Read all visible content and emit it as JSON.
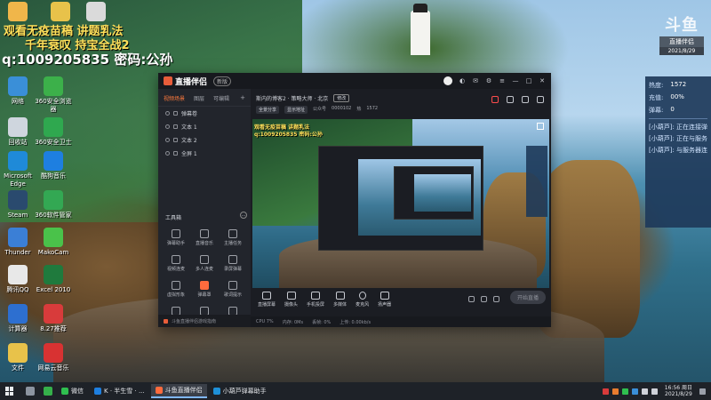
{
  "overlay": {
    "line1": "观看无疫苗稿 讲题乳法",
    "line2": "千年衰叹 持宝全战2",
    "line3": "q:1009205835 密码:公孙"
  },
  "desktop_icons": [
    {
      "label": "",
      "icon": "doc-icon",
      "color": "#f0b64a"
    },
    {
      "label": "",
      "icon": "folder-icon",
      "color": "#e8c24a"
    },
    {
      "label": "",
      "icon": "file-icon",
      "color": "#dadada"
    },
    {
      "label": "网络",
      "icon": "network-icon",
      "color": "#3a8fd8"
    },
    {
      "label": "360安全浏览器",
      "icon": "browser-360-icon",
      "color": "#3cb04a"
    },
    {
      "label": "回收站",
      "icon": "recycle-bin-icon",
      "color": "#cfd6de"
    },
    {
      "label": "360安全卫士",
      "icon": "shield-360-icon",
      "color": "#2fa84f"
    },
    {
      "label": "Microsoft Edge",
      "icon": "edge-icon",
      "color": "#1f8ad8"
    },
    {
      "label": "酷狗音乐",
      "icon": "kugou-icon",
      "color": "#1e7fe0"
    },
    {
      "label": "Steam",
      "icon": "steam-icon",
      "color": "#2a4a6e"
    },
    {
      "label": "360软件管家",
      "icon": "software-manager-icon",
      "color": "#33a853"
    },
    {
      "label": "Thunder",
      "icon": "thunder-icon",
      "color": "#3b7fd6"
    },
    {
      "label": "MakoCam",
      "icon": "makocam-icon",
      "color": "#4ac24a"
    },
    {
      "label": "腾讯QQ",
      "icon": "qq-icon",
      "color": "#e8e8e8"
    },
    {
      "label": "Excel 2010",
      "icon": "excel-icon",
      "color": "#1f7a3d"
    },
    {
      "label": "计算器",
      "icon": "calculator-icon",
      "color": "#2d6fd0"
    },
    {
      "label": "8.27推荐",
      "icon": "recommend-icon",
      "color": "#d83b3b"
    },
    {
      "label": "文件",
      "icon": "file-folder-icon",
      "color": "#e8c24a"
    },
    {
      "label": "网易云音乐",
      "icon": "netease-music-icon",
      "color": "#d83232"
    }
  ],
  "top_right": {
    "big": "斗鱼",
    "badge": "直播伴侣",
    "small": "2021/8/29"
  },
  "stats_panel": {
    "heat_label": "热度:",
    "heat_value": "1572",
    "gift_label": "充值:",
    "gift_value": "00%",
    "fans_label": "弹幕:",
    "fans_value": "0",
    "log": [
      "[小葫芦]: 正在连接弹",
      "[小葫芦]: 正在与服务",
      "[小葫芦]: 与服务器连"
    ]
  },
  "app": {
    "brand": "直播伴侣",
    "version": "新版",
    "tabs": [
      "视频场景",
      "图层",
      "可编辑"
    ],
    "scenes": [
      "弹幕卷",
      "文本 1",
      "文本 2",
      "全屏 1"
    ],
    "toolbox_title": "工具箱",
    "tools": [
      "弹幕助手",
      "直播音乐",
      "主播任务",
      "视频连麦",
      "多人连麦",
      "录屏弹幕",
      "虚拟形象",
      "弹幕罩",
      "歌词提示",
      "",
      "",
      ""
    ],
    "left_footer": "斗鱼直播伴侣游戏指南",
    "room_title": "斯内的博客2 · 策略大师 · 北京",
    "room_tag": "修改",
    "metrics": [
      "全景分享",
      "显示地址",
      "公众号",
      "0000102",
      "热",
      "1572"
    ],
    "preview_text": [
      "观看无疫苗稿 讲题乳法",
      "q:1009205835 密码:公孙"
    ],
    "controls": [
      "直播屏幕",
      "摄像头",
      "手机投屏",
      "多媒体",
      "麦克风",
      "扬声器"
    ],
    "start_label": "开始直播",
    "status": [
      "CPU 7%",
      "内存: 0Ms",
      "丢帧: 0%",
      "上传: 0.00kb/s"
    ]
  },
  "taskbar": {
    "apps": [
      {
        "label": "微信",
        "color": "#2fbf4f"
      },
      {
        "label": "K · 半生雪 · ...",
        "color": "#1e7fe0"
      },
      {
        "label": "斗鱼直播伴侣",
        "color": "#ff6b3d"
      },
      {
        "label": "小葫芦弹幕助手",
        "color": "#1e90d8"
      }
    ],
    "time": "16:56 周日",
    "date": "2021/8/29"
  }
}
